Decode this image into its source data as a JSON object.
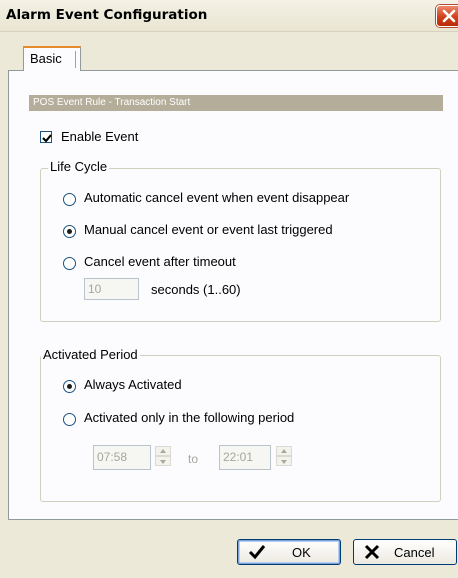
{
  "window": {
    "title": "Alarm Event Configuration",
    "close_icon": "close-icon"
  },
  "tabs": [
    {
      "label": "Basic",
      "selected": true
    }
  ],
  "rule_header": "POS Event Rule - Transaction Start",
  "enable_event": {
    "label": "Enable Event",
    "checked": true
  },
  "life_cycle": {
    "legend": "Life Cycle",
    "options": [
      {
        "label": "Automatic cancel event when event disappear",
        "selected": false
      },
      {
        "label": "Manual cancel event or event last triggered",
        "selected": true
      },
      {
        "label": "Cancel event after timeout",
        "selected": false
      }
    ],
    "timeout_value": "10",
    "timeout_unit": "seconds (1..60)"
  },
  "activated_period": {
    "legend": "Activated Period",
    "options": [
      {
        "label": "Always Activated",
        "selected": true
      },
      {
        "label": "Activated only in the following period",
        "selected": false
      }
    ],
    "from_time": "07:58",
    "to_label": "to",
    "to_time": "22:01"
  },
  "buttons": {
    "ok": "OK",
    "cancel": "Cancel"
  },
  "colors": {
    "accent_tab": "#e68b2c",
    "header_bar": "#b4ad9a",
    "close_button": "#d1401c"
  }
}
